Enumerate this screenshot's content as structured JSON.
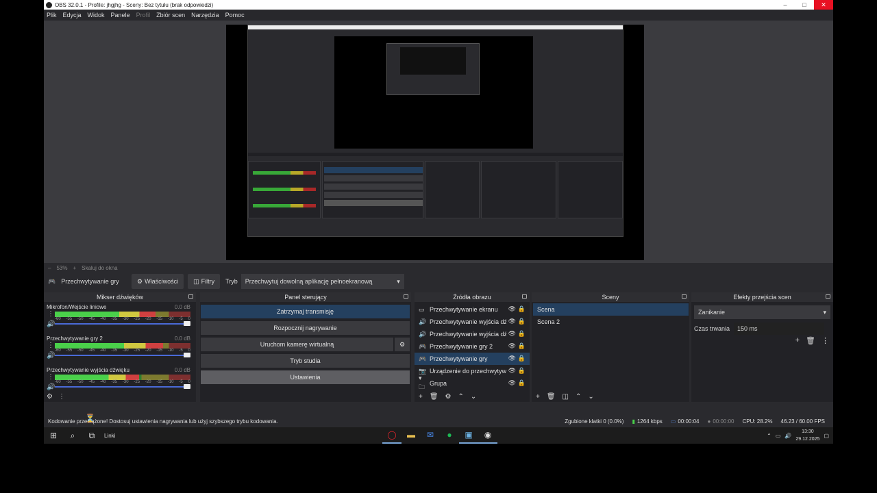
{
  "window": {
    "title": "OBS 32.0.1 - Profile: jhgjhg - Sceny: Bez tytułu (brak odpowiedzi)",
    "controls": [
      "–",
      "□",
      "✕"
    ]
  },
  "menu": [
    "Plik",
    "Edycja",
    "Widok",
    "Panele",
    "Profil",
    "Zbiór scen",
    "Narzędzia",
    "Pomoc"
  ],
  "zoom": {
    "minus": "–",
    "value": "53%",
    "plus": "+",
    "label": "Skaluj do okna"
  },
  "toolbar": {
    "source_name": "Przechwytywanie gry",
    "properties": "Właściwości",
    "filters": "Filtry",
    "mode_label": "Tryb",
    "mode_value": "Przechwytuj dowolną aplikację pełnoekranową"
  },
  "mixer": {
    "title": "Mikser dźwięków",
    "ticks": [
      "-60",
      "-55",
      "-50",
      "-45",
      "-40",
      "-35",
      "-30",
      "-25",
      "-20",
      "-15",
      "-10",
      "-5",
      "0"
    ],
    "channels": [
      {
        "name": "Mikrofon/Wejście liniowe",
        "db": "0.0 dB",
        "level": 0.74
      },
      {
        "name": "Przechwytywanie gry 2",
        "db": "0.0 dB",
        "level": 0.8
      },
      {
        "name": "Przechwytywanie wyjścia dźwięku",
        "db": "0.0 dB",
        "level": 0.62
      }
    ]
  },
  "controls": {
    "title": "Panel sterujący",
    "stream": "Zatrzymaj transmisję",
    "record": "Rozpocznij nagrywanie",
    "vcam": "Uruchom kamerę wirtualną",
    "studio": "Tryb studia",
    "settings": "Ustawienia"
  },
  "sources": {
    "title": "Źródła obrazu",
    "items": [
      {
        "icon": "▭",
        "label": "Przechwytywanie ekranu"
      },
      {
        "icon": "🔊",
        "label": "Przechwytywanie wyjścia dźwię"
      },
      {
        "icon": "🔊",
        "label": "Przechwytywanie wyjścia dźwię"
      },
      {
        "icon": "🎮",
        "label": "Przechwytywanie gry 2"
      },
      {
        "icon": "🎮",
        "label": "Przechwytywanie gry"
      },
      {
        "icon": "📷",
        "label": "Urządzenie do przechwytywani"
      },
      {
        "icon": "▾ 🗀",
        "label": "Grupa"
      }
    ]
  },
  "scenes": {
    "title": "Sceny",
    "items": [
      "Scena",
      "Scena 2"
    ]
  },
  "transitions": {
    "title": "Efekty przejścia scen",
    "type": "Zanikanie",
    "duration_label": "Czas trwania",
    "duration_value": "150 ms"
  },
  "status": {
    "message": "Kodowanie przeciążone! Dostosuj ustawienia nagrywania lub użyj szybszego trybu kodowania.",
    "dropped": "Zgubione klatki 0 (0.0%)",
    "bitrate": "1264 kbps",
    "stream_time": "00:00:04",
    "rec_time": "00:00:00",
    "cpu": "CPU: 28.2%",
    "fps": "46.23 / 60.00 FPS"
  },
  "taskbar": {
    "links": "Linki",
    "time": "13:30",
    "date": "29.12.2025"
  },
  "colors": {
    "accent": "#24405f",
    "bg": "#2a2a2e",
    "close": "#e81123"
  }
}
